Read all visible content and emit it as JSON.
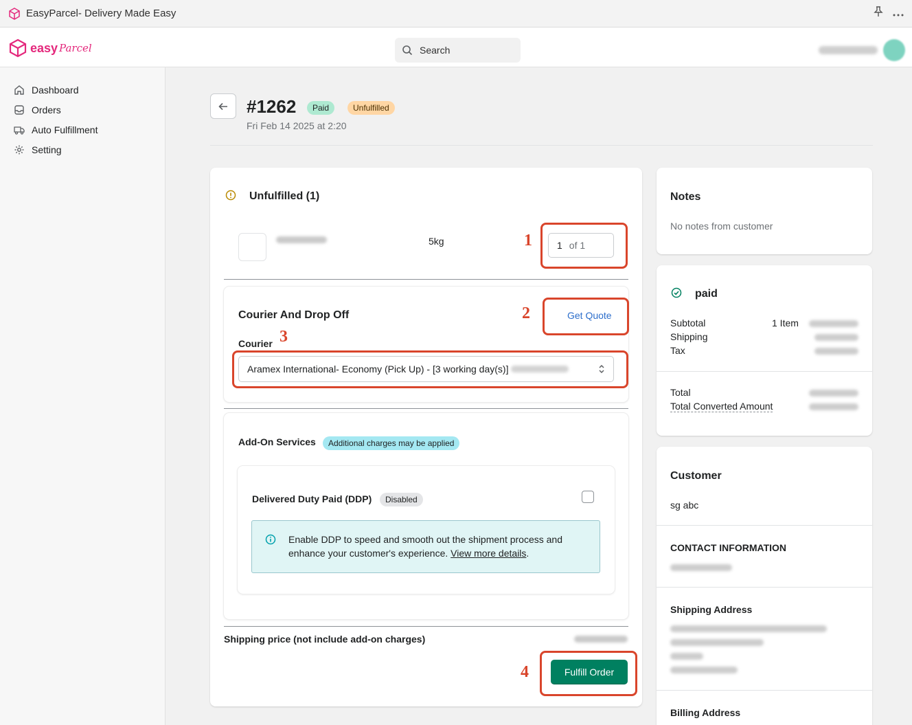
{
  "window": {
    "title": "EasyParcel- Delivery Made Easy"
  },
  "brand": {
    "word": "easy",
    "script": "Parcel"
  },
  "search": {
    "label": "Search"
  },
  "sidebar": {
    "items": [
      {
        "label": "Dashboard"
      },
      {
        "label": "Orders"
      },
      {
        "label": "Auto Fulfillment"
      },
      {
        "label": "Setting"
      }
    ]
  },
  "order": {
    "number": "#1262",
    "payment_badge": "Paid",
    "fulfillment_badge": "Unfulfilled",
    "date": "Fri Feb 14 2025 at 2:20"
  },
  "unfulfilled": {
    "title": "Unfulfilled (1)",
    "weight": "5kg",
    "qty_value": "1",
    "qty_of": "of 1"
  },
  "courier": {
    "section_title": "Courier And Drop Off",
    "get_quote": "Get Quote",
    "label": "Courier",
    "selected": "Aramex International- Economy (Pick Up) - [3 working day(s)]"
  },
  "addons": {
    "title": "Add-On Services",
    "badge": "Additional charges may be applied",
    "ddp_title": "Delivered Duty Paid (DDP)",
    "ddp_badge": "Disabled",
    "ddp_info": "Enable DDP to speed and smooth out the shipment process and enhance your customer's experience.",
    "ddp_link": "View more details",
    "ddp_link_suffix": "."
  },
  "shipping": {
    "label": "Shipping price (not include add-on charges)"
  },
  "fulfill": {
    "label": "Fulfill Order"
  },
  "annotations": [
    "1",
    "2",
    "3",
    "4"
  ],
  "notes": {
    "title": "Notes",
    "text": "No notes from customer"
  },
  "payment": {
    "status": "paid",
    "subtotal": "Subtotal",
    "items": "1 Item",
    "shipping": "Shipping",
    "tax": "Tax",
    "total": "Total",
    "converted": "Total Converted Amount"
  },
  "customer": {
    "title": "Customer",
    "name": "sg abc",
    "contact_title": "CONTACT INFORMATION",
    "shipping_title": "Shipping Address",
    "billing_title": "Billing Address"
  },
  "colors": {
    "accent": "#008060",
    "brand": "#e4287c",
    "annotation": "#d9452b",
    "link": "#2c6ecb"
  }
}
